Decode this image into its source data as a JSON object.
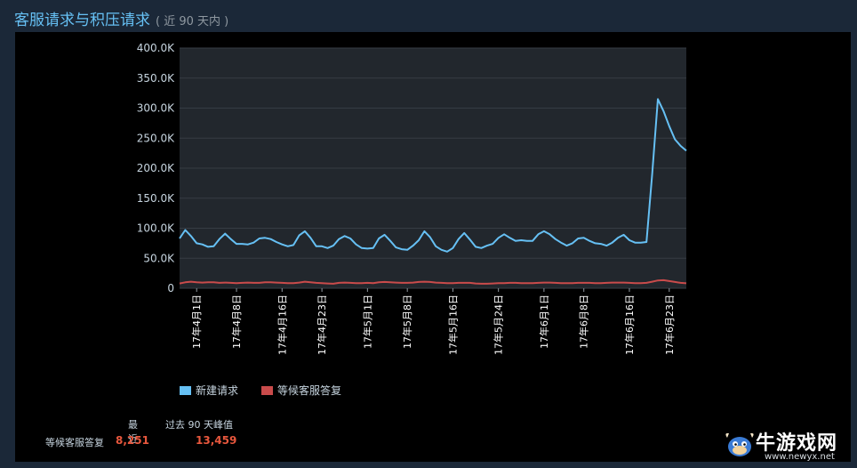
{
  "header": {
    "title": "客服请求与积压请求",
    "subtitle": "( 近 90 天内 )"
  },
  "chart_data": {
    "type": "line",
    "ylim": [
      0,
      400000
    ],
    "yticks": [
      "0",
      "50.0K",
      "100.0K",
      "150.0K",
      "200.0K",
      "250.0K",
      "300.0K",
      "350.0K",
      "400.0K"
    ],
    "x_tick_labels": [
      {
        "index": 3,
        "label": "17年4月1日"
      },
      {
        "index": 10,
        "label": "17年4月8日"
      },
      {
        "index": 18,
        "label": "17年4月16日"
      },
      {
        "index": 25,
        "label": "17年4月23日"
      },
      {
        "index": 33,
        "label": "17年5月1日"
      },
      {
        "index": 40,
        "label": "17年5月8日"
      },
      {
        "index": 48,
        "label": "17年5月16日"
      },
      {
        "index": 56,
        "label": "17年5月24日"
      },
      {
        "index": 64,
        "label": "17年6月1日"
      },
      {
        "index": 71,
        "label": "17年6月8日"
      },
      {
        "index": 79,
        "label": "17年6月16日"
      },
      {
        "index": 86,
        "label": "17年6月23日"
      }
    ],
    "grid": true,
    "legend_position": "bottom",
    "series": [
      {
        "name": "新建请求",
        "color": "#66c0f4",
        "values": [
          83000,
          97000,
          87000,
          75000,
          73000,
          69000,
          70000,
          82000,
          91000,
          82000,
          74000,
          74000,
          73000,
          76000,
          83000,
          84000,
          82000,
          77000,
          73000,
          70000,
          72000,
          88000,
          95000,
          84000,
          70000,
          70000,
          67000,
          71000,
          82000,
          87000,
          83000,
          73000,
          67000,
          66000,
          67000,
          83000,
          89000,
          79000,
          68000,
          65000,
          64000,
          71000,
          80000,
          95000,
          85000,
          70000,
          64000,
          61000,
          67000,
          82000,
          92000,
          81000,
          69000,
          67000,
          71000,
          74000,
          84000,
          90000,
          84000,
          79000,
          80000,
          79000,
          79000,
          90000,
          95000,
          90000,
          82000,
          76000,
          71000,
          75000,
          83000,
          84000,
          79000,
          75000,
          74000,
          71000,
          76000,
          84000,
          89000,
          80000,
          76000,
          76000,
          77000,
          190000,
          315000,
          295000,
          270000,
          248000,
          237000,
          229000
        ],
        "peak": 315000
      },
      {
        "name": "等候客服答复",
        "color": "#c94b4b",
        "values": [
          8000,
          10000,
          11000,
          10000,
          9500,
          10000,
          10000,
          9000,
          9500,
          9000,
          8500,
          9000,
          9500,
          9000,
          9000,
          10000,
          10000,
          9500,
          9000,
          8500,
          8500,
          9500,
          11000,
          10000,
          9000,
          8500,
          8000,
          7500,
          9000,
          9500,
          9000,
          8500,
          8500,
          9000,
          8500,
          10000,
          10500,
          10000,
          9500,
          9000,
          9000,
          9500,
          10500,
          11000,
          10500,
          9500,
          9000,
          8500,
          8500,
          9000,
          9000,
          9000,
          8000,
          7500,
          7500,
          8000,
          8500,
          8500,
          9000,
          9000,
          8500,
          8500,
          8500,
          9000,
          9500,
          9500,
          9000,
          8500,
          8500,
          8500,
          9000,
          9000,
          9000,
          8500,
          8500,
          9000,
          9500,
          9500,
          9500,
          9000,
          8500,
          8500,
          9000,
          11000,
          13000,
          13459,
          12000,
          10500,
          9000,
          8251
        ]
      }
    ]
  },
  "legend": [
    {
      "label": "新建请求",
      "color": "#66c0f4"
    },
    {
      "label": "等候客服答复",
      "color": "#c94b4b"
    }
  ],
  "stats": {
    "col_recent": "最近",
    "col_peak": "过去 90 天峰值",
    "row_label": "等候客服答复",
    "recent_value": "8,251",
    "peak_value": "13,459"
  },
  "watermark": {
    "text": "牛游戏网",
    "url": "www.newyx.net"
  }
}
